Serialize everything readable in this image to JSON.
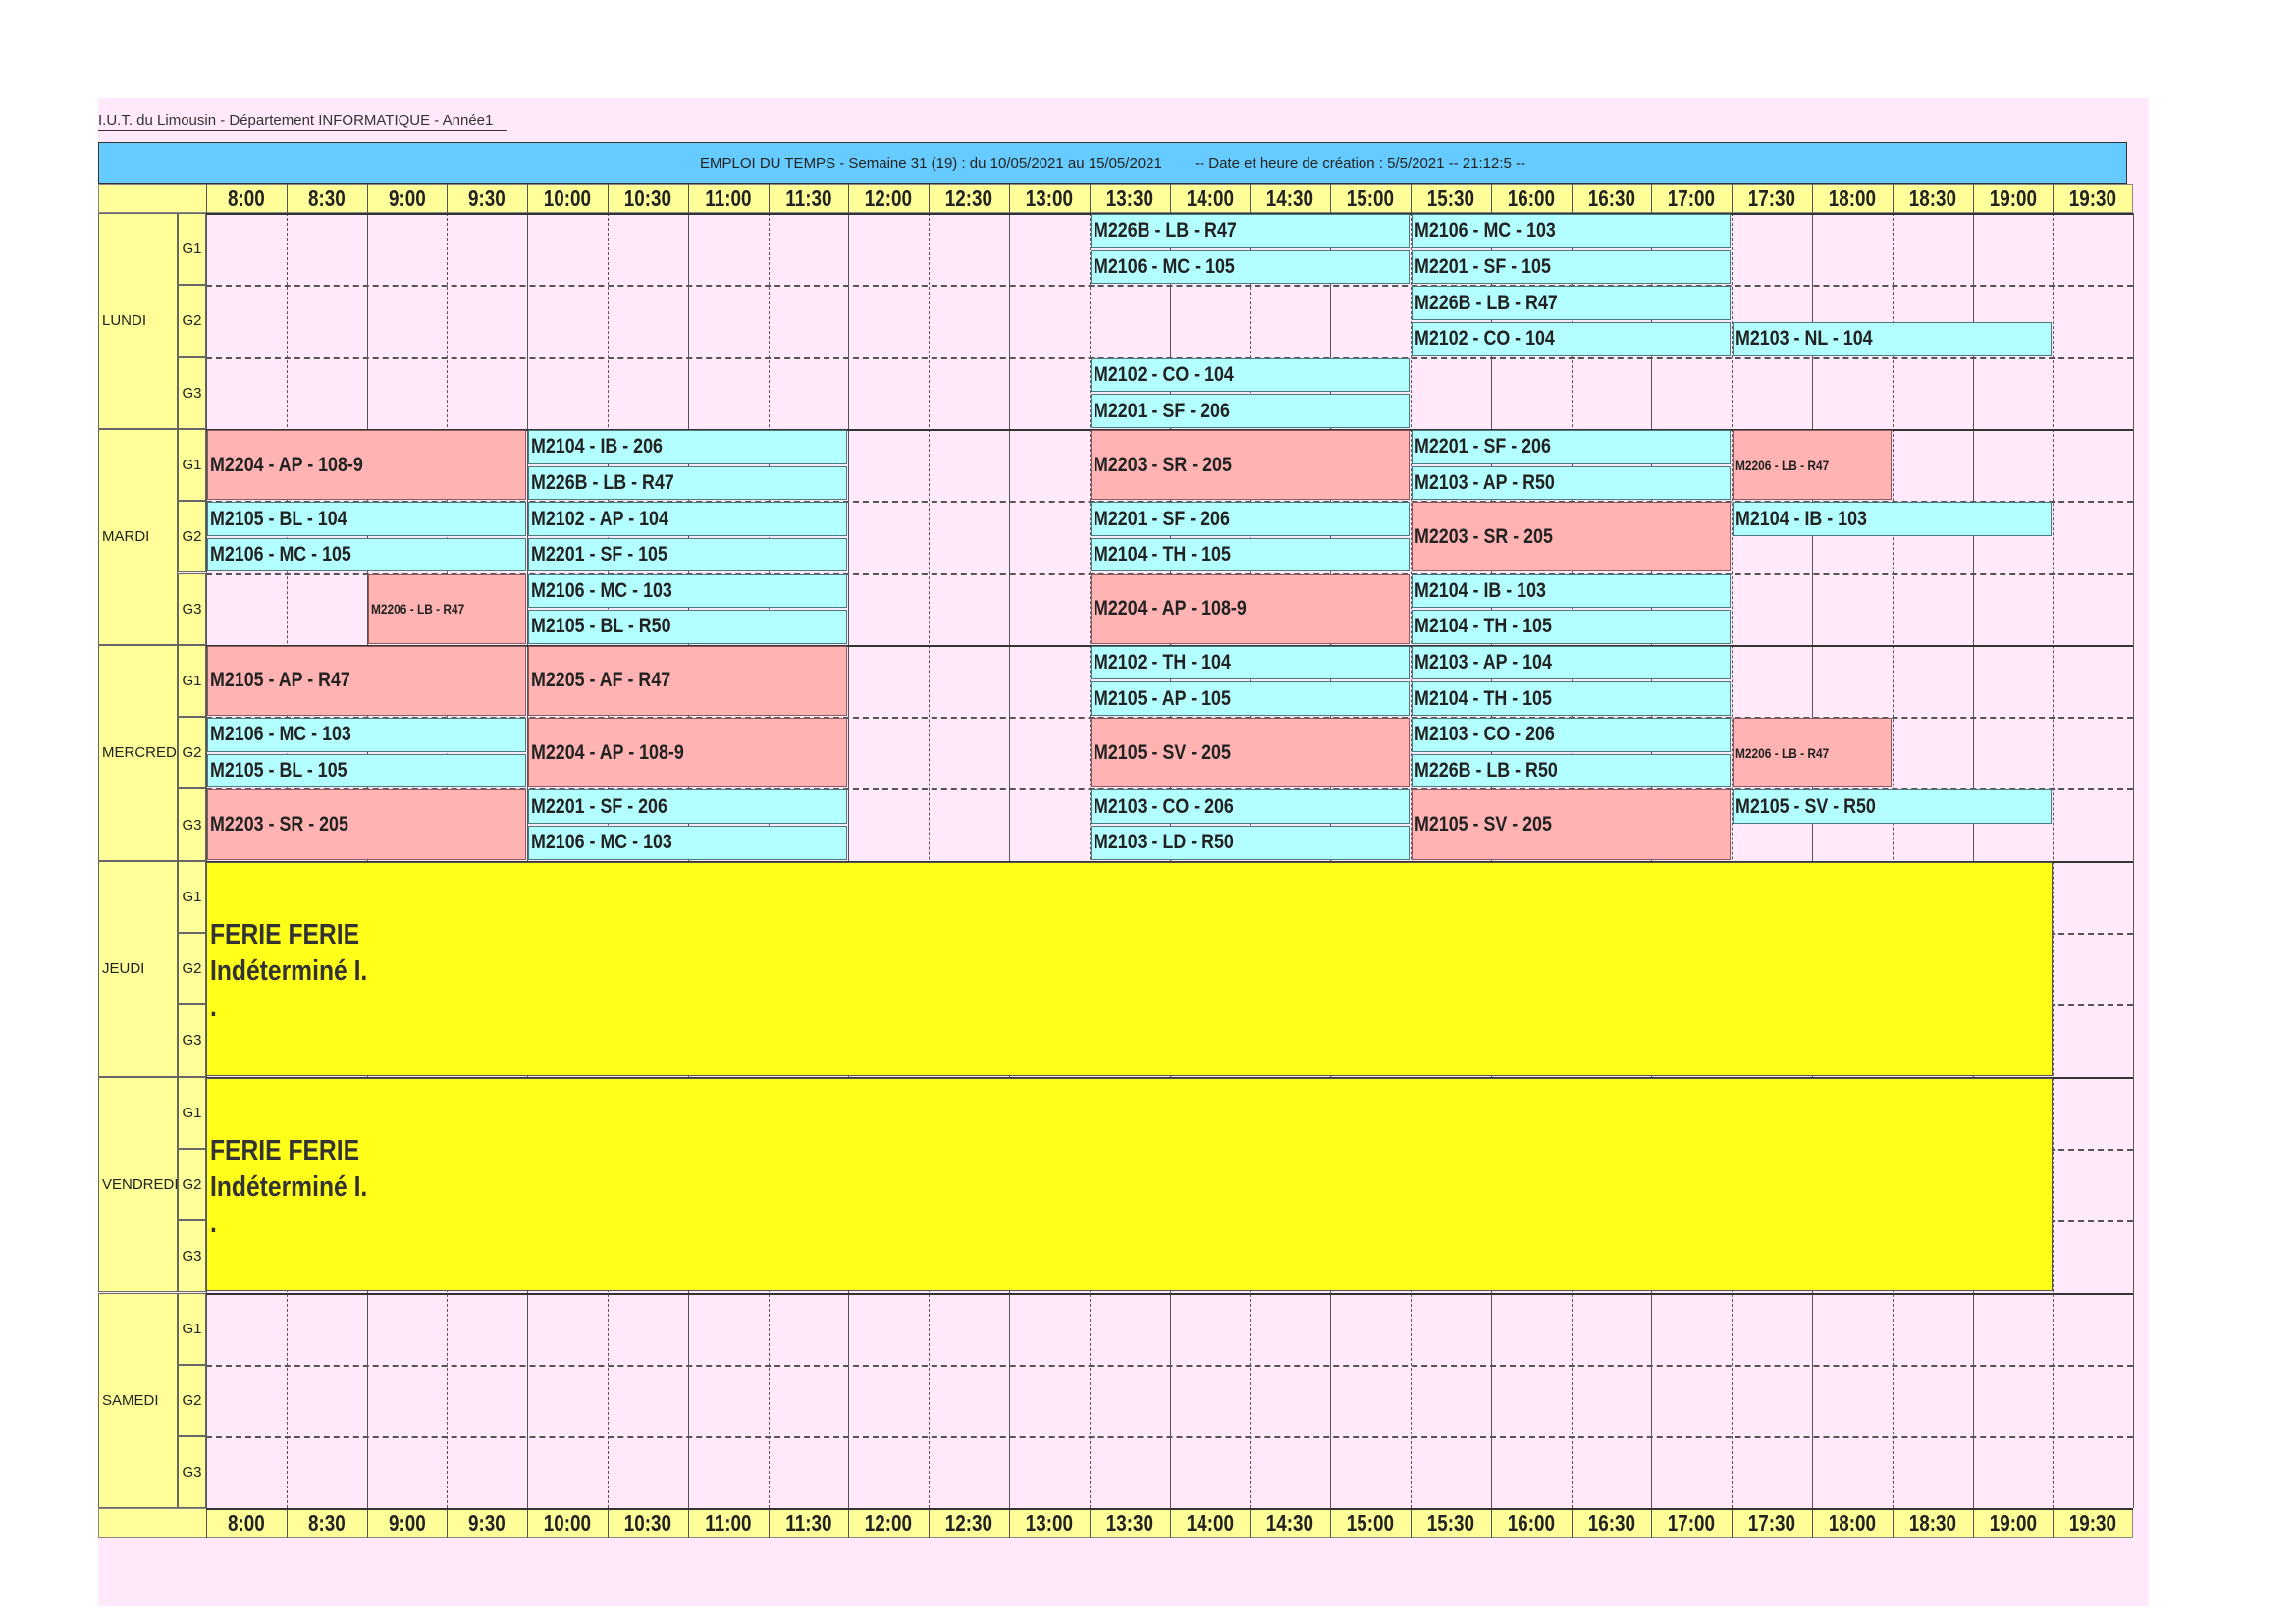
{
  "header": {
    "school": "I.U.T. du Limousin - Département INFORMATIQUE - Année1",
    "title": "EMPLOI DU TEMPS - Semaine 31 (19) : du 10/05/2021 au 15/05/2021        -- Date et heure de création : 5/5/2021 -- 21:12:5 --"
  },
  "times": [
    "8:00",
    "8:30",
    "9:00",
    "9:30",
    "10:00",
    "10:30",
    "11:00",
    "11:30",
    "12:00",
    "12:30",
    "13:00",
    "13:30",
    "14:00",
    "14:30",
    "15:00",
    "15:30",
    "16:00",
    "16:30",
    "17:00",
    "17:30",
    "18:00",
    "18:30",
    "19:00",
    "19:30"
  ],
  "groups": [
    "G1",
    "G2",
    "G3"
  ],
  "days": [
    "LUNDI",
    "MARDI",
    "MERCREDI",
    "JEUDI",
    "VENDREDI",
    "SAMEDI"
  ],
  "colors": {
    "tp": "#b3ffff",
    "td": "#ffb3b3",
    "ferie": "#ffff1a",
    "header": "#ffff99",
    "title_bar": "#66ccff",
    "background": "#ffe9fb"
  },
  "events": [
    {
      "day": 0,
      "group": 0,
      "half": 0,
      "start": 11,
      "end": 15,
      "label": "M226B - LB - R47",
      "type": "tp"
    },
    {
      "day": 0,
      "group": 0,
      "half": 1,
      "start": 11,
      "end": 15,
      "label": "M2106 - MC - 105",
      "type": "tp"
    },
    {
      "day": 0,
      "group": 0,
      "half": 0,
      "start": 15,
      "end": 19,
      "label": "M2106 - MC - 103",
      "type": "tp"
    },
    {
      "day": 0,
      "group": 0,
      "half": 1,
      "start": 15,
      "end": 19,
      "label": "M2201 - SF - 105",
      "type": "tp"
    },
    {
      "day": 0,
      "group": 1,
      "half": 0,
      "start": 15,
      "end": 19,
      "label": "M226B - LB - R47",
      "type": "tp"
    },
    {
      "day": 0,
      "group": 1,
      "half": 1,
      "start": 15,
      "end": 19,
      "label": "M2102 - CO - 104",
      "type": "tp"
    },
    {
      "day": 0,
      "group": 1,
      "half": 1,
      "start": 19,
      "end": 23,
      "label": "M2103 - NL - 104",
      "type": "tp"
    },
    {
      "day": 0,
      "group": 2,
      "half": 0,
      "start": 11,
      "end": 15,
      "label": "M2102 - CO - 104",
      "type": "tp"
    },
    {
      "day": 0,
      "group": 2,
      "half": 1,
      "start": 11,
      "end": 15,
      "label": "M2201 - SF - 206",
      "type": "tp"
    },
    {
      "day": 1,
      "group": 0,
      "half": 2,
      "start": 0,
      "end": 4,
      "label": "M2204 - AP - 108-9",
      "type": "td"
    },
    {
      "day": 1,
      "group": 0,
      "half": 0,
      "start": 4,
      "end": 8,
      "label": "M2104 - IB - 206",
      "type": "tp"
    },
    {
      "day": 1,
      "group": 0,
      "half": 1,
      "start": 4,
      "end": 8,
      "label": "M226B - LB - R47",
      "type": "tp"
    },
    {
      "day": 1,
      "group": 0,
      "half": 2,
      "start": 11,
      "end": 15,
      "label": "M2203 - SR - 205",
      "type": "td"
    },
    {
      "day": 1,
      "group": 0,
      "half": 0,
      "start": 15,
      "end": 19,
      "label": "M2201 - SF - 206",
      "type": "tp"
    },
    {
      "day": 1,
      "group": 0,
      "half": 1,
      "start": 15,
      "end": 19,
      "label": "M2103 - AP - R50",
      "type": "tp"
    },
    {
      "day": 1,
      "group": 0,
      "half": 2,
      "start": 19,
      "end": 21,
      "label": "M2206 - LB - R47",
      "type": "td",
      "small": true
    },
    {
      "day": 1,
      "group": 1,
      "half": 0,
      "start": 0,
      "end": 4,
      "label": "M2105 - BL - 104",
      "type": "tp"
    },
    {
      "day": 1,
      "group": 1,
      "half": 1,
      "start": 0,
      "end": 4,
      "label": "M2106 - MC - 105",
      "type": "tp"
    },
    {
      "day": 1,
      "group": 1,
      "half": 0,
      "start": 4,
      "end": 8,
      "label": "M2102 - AP - 104",
      "type": "tp"
    },
    {
      "day": 1,
      "group": 1,
      "half": 1,
      "start": 4,
      "end": 8,
      "label": "M2201 - SF - 105",
      "type": "tp"
    },
    {
      "day": 1,
      "group": 1,
      "half": 0,
      "start": 11,
      "end": 15,
      "label": "M2201 - SF - 206",
      "type": "tp"
    },
    {
      "day": 1,
      "group": 1,
      "half": 1,
      "start": 11,
      "end": 15,
      "label": "M2104 - TH - 105",
      "type": "tp"
    },
    {
      "day": 1,
      "group": 1,
      "half": 2,
      "start": 15,
      "end": 19,
      "label": "M2203 - SR - 205",
      "type": "td"
    },
    {
      "day": 1,
      "group": 1,
      "half": 0,
      "start": 19,
      "end": 23,
      "label": "M2104 - IB - 103",
      "type": "tp"
    },
    {
      "day": 1,
      "group": 2,
      "half": 2,
      "start": 2,
      "end": 4,
      "label": "M2206 - LB - R47",
      "type": "td",
      "small": true
    },
    {
      "day": 1,
      "group": 2,
      "half": 0,
      "start": 4,
      "end": 8,
      "label": "M2106 - MC - 103",
      "type": "tp"
    },
    {
      "day": 1,
      "group": 2,
      "half": 1,
      "start": 4,
      "end": 8,
      "label": "M2105 - BL - R50",
      "type": "tp"
    },
    {
      "day": 1,
      "group": 2,
      "half": 2,
      "start": 11,
      "end": 15,
      "label": "M2204 - AP - 108-9",
      "type": "td"
    },
    {
      "day": 1,
      "group": 2,
      "half": 0,
      "start": 15,
      "end": 19,
      "label": "M2104 - IB - 103",
      "type": "tp"
    },
    {
      "day": 1,
      "group": 2,
      "half": 1,
      "start": 15,
      "end": 19,
      "label": "M2104 - TH - 105",
      "type": "tp"
    },
    {
      "day": 2,
      "group": 0,
      "half": 2,
      "start": 0,
      "end": 4,
      "label": "M2105 - AP - R47",
      "type": "td"
    },
    {
      "day": 2,
      "group": 0,
      "half": 2,
      "start": 4,
      "end": 8,
      "label": "M2205 - AF - R47",
      "type": "td"
    },
    {
      "day": 2,
      "group": 0,
      "half": 0,
      "start": 11,
      "end": 15,
      "label": "M2102 - TH - 104",
      "type": "tp"
    },
    {
      "day": 2,
      "group": 0,
      "half": 1,
      "start": 11,
      "end": 15,
      "label": "M2105 - AP - 105",
      "type": "tp"
    },
    {
      "day": 2,
      "group": 0,
      "half": 0,
      "start": 15,
      "end": 19,
      "label": "M2103 - AP - 104",
      "type": "tp"
    },
    {
      "day": 2,
      "group": 0,
      "half": 1,
      "start": 15,
      "end": 19,
      "label": "M2104 - TH - 105",
      "type": "tp"
    },
    {
      "day": 2,
      "group": 1,
      "half": 0,
      "start": 0,
      "end": 4,
      "label": "M2106 - MC - 103",
      "type": "tp"
    },
    {
      "day": 2,
      "group": 1,
      "half": 1,
      "start": 0,
      "end": 4,
      "label": "M2105 - BL - 105",
      "type": "tp"
    },
    {
      "day": 2,
      "group": 1,
      "half": 2,
      "start": 4,
      "end": 8,
      "label": "M2204 - AP - 108-9",
      "type": "td"
    },
    {
      "day": 2,
      "group": 1,
      "half": 2,
      "start": 11,
      "end": 15,
      "label": "M2105 - SV - 205",
      "type": "td"
    },
    {
      "day": 2,
      "group": 1,
      "half": 0,
      "start": 15,
      "end": 19,
      "label": "M2103 - CO - 206",
      "type": "tp"
    },
    {
      "day": 2,
      "group": 1,
      "half": 1,
      "start": 15,
      "end": 19,
      "label": "M226B - LB - R50",
      "type": "tp"
    },
    {
      "day": 2,
      "group": 1,
      "half": 2,
      "start": 19,
      "end": 21,
      "label": "M2206 - LB - R47",
      "type": "td",
      "small": true
    },
    {
      "day": 2,
      "group": 2,
      "half": 2,
      "start": 0,
      "end": 4,
      "label": "M2203 - SR - 205",
      "type": "td"
    },
    {
      "day": 2,
      "group": 2,
      "half": 0,
      "start": 4,
      "end": 8,
      "label": "M2201 - SF - 206",
      "type": "tp"
    },
    {
      "day": 2,
      "group": 2,
      "half": 1,
      "start": 4,
      "end": 8,
      "label": "M2106 - MC - 103",
      "type": "tp"
    },
    {
      "day": 2,
      "group": 2,
      "half": 0,
      "start": 11,
      "end": 15,
      "label": "M2103 - CO - 206",
      "type": "tp"
    },
    {
      "day": 2,
      "group": 2,
      "half": 1,
      "start": 11,
      "end": 15,
      "label": "M2103 - LD - R50",
      "type": "tp"
    },
    {
      "day": 2,
      "group": 2,
      "half": 2,
      "start": 15,
      "end": 19,
      "label": "M2105 - SV - 205",
      "type": "td"
    },
    {
      "day": 2,
      "group": 2,
      "half": 0,
      "start": 19,
      "end": 23,
      "label": "M2105 - SV - R50",
      "type": "tp"
    }
  ],
  "ferie": [
    {
      "day": 3,
      "lines": [
        "FERIE FERIE",
        "Indéterminé I.",
        "."
      ]
    },
    {
      "day": 4,
      "lines": [
        "FERIE FERIE",
        "Indéterminé I.",
        "."
      ]
    }
  ]
}
